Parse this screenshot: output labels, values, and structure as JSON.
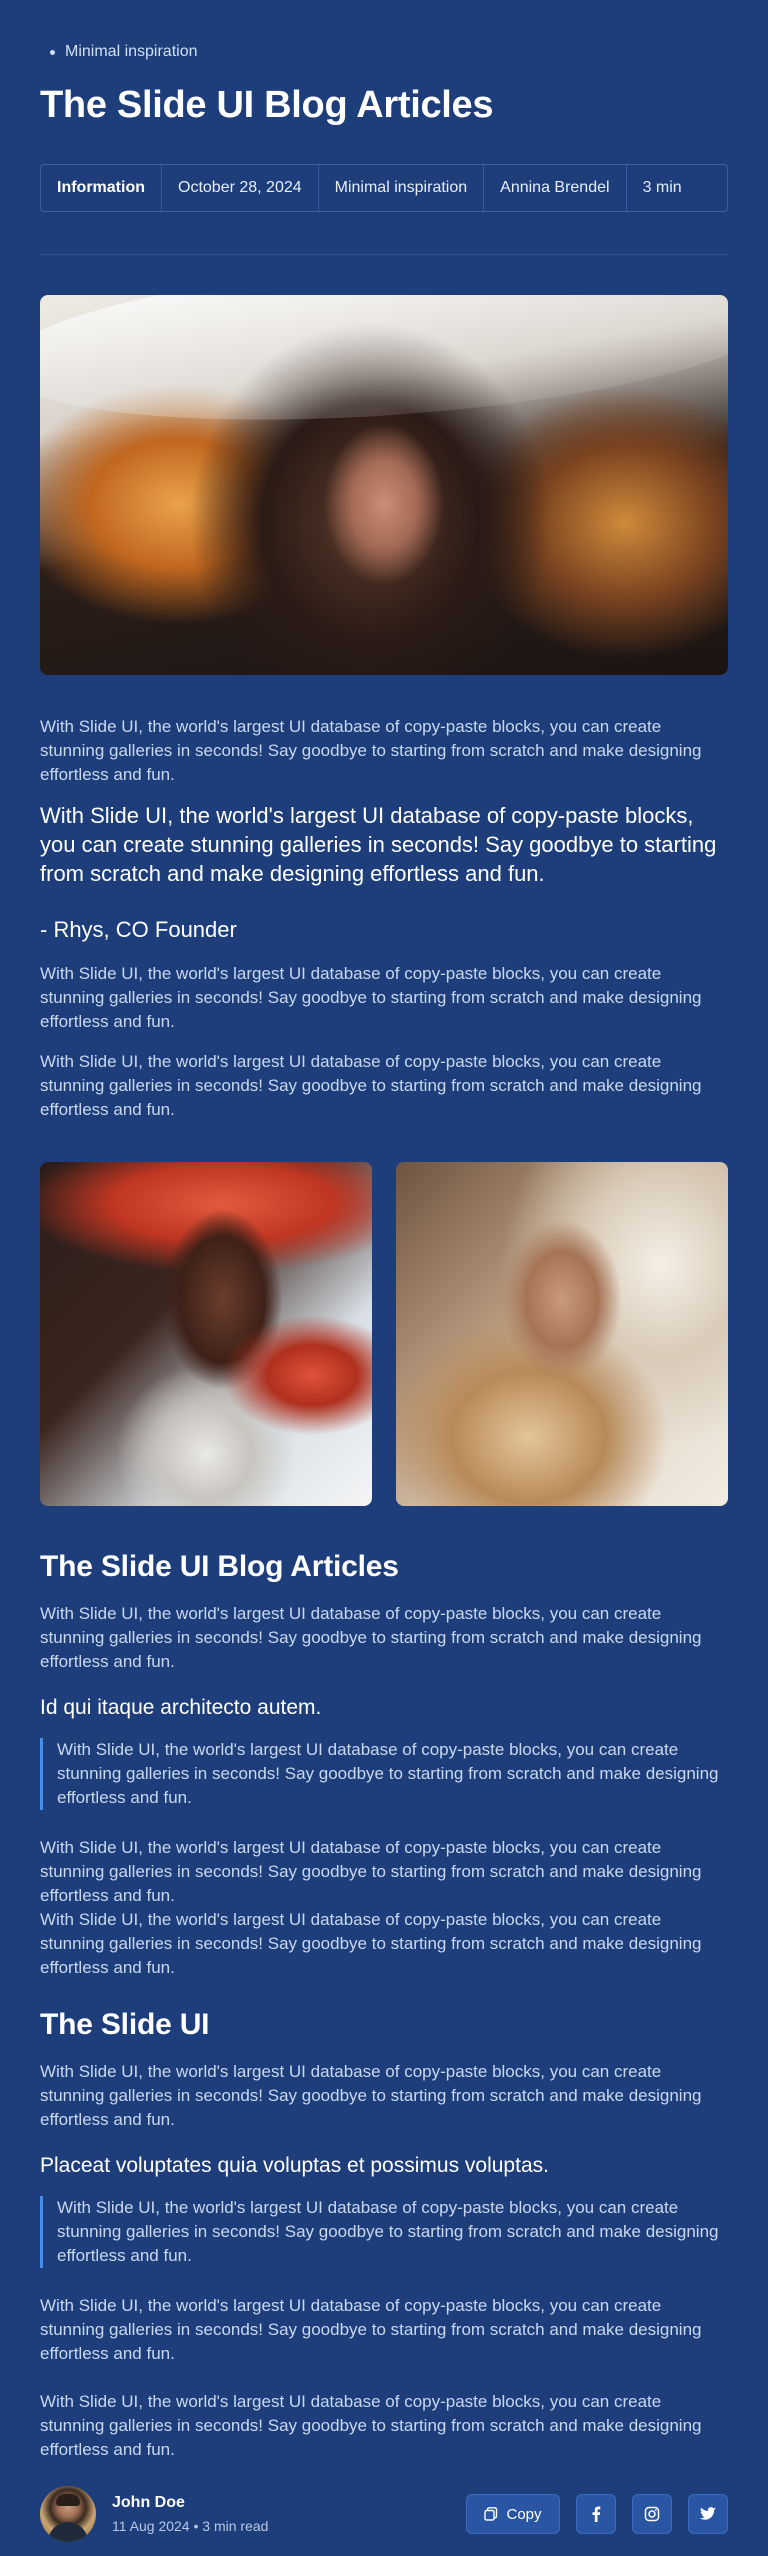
{
  "breadcrumb": {
    "label": "Minimal inspiration"
  },
  "page_title": "The Slide UI Blog Articles",
  "meta": {
    "info": "Information",
    "date": "October 28, 2024",
    "category": "Minimal inspiration",
    "author": "Annina Brendel",
    "read": "3 min"
  },
  "article": {
    "p1": "With Slide UI, the world's largest UI database of copy-paste blocks, you can create stunning galleries in seconds! Say goodbye to starting from scratch and make designing effortless and fun.",
    "quote": "With Slide UI, the world's largest UI database of copy-paste blocks, you can create stunning galleries in seconds! Say goodbye to starting from scratch and make designing effortless and fun.",
    "quote_author": "- Rhys, CO Founder",
    "p2": "With Slide UI, the world's largest UI database of copy-paste blocks, you can create stunning galleries in seconds! Say goodbye to starting from scratch and make designing effortless and fun.",
    "p3": "With Slide UI, the world's largest UI database of copy-paste blocks, you can create stunning galleries in seconds! Say goodbye to starting from scratch and make designing effortless and fun.",
    "section1": {
      "heading": "The Slide UI Blog Articles",
      "p1": "With Slide UI, the world's largest UI database of copy-paste blocks, you can create stunning galleries in seconds! Say goodbye to starting from scratch and make designing effortless and fun.",
      "subheading": "Id qui itaque architecto autem.",
      "blockquote": "With Slide UI, the world's largest UI database of copy-paste blocks, you can create stunning galleries in seconds! Say goodbye to starting from scratch and make designing effortless and fun.",
      "p2": "With Slide UI, the world's largest UI database of copy-paste blocks, you can create stunning galleries in seconds! Say goodbye to starting from scratch and make designing effortless and fun.",
      "p3": "With Slide UI, the world's largest UI database of copy-paste blocks, you can create stunning galleries in seconds! Say goodbye to starting from scratch and make designing effortless and fun."
    },
    "section2": {
      "heading": "The Slide UI",
      "p1": "With Slide UI, the world's largest UI database of copy-paste blocks, you can create stunning galleries in seconds! Say goodbye to starting from scratch and make designing effortless and fun.",
      "subheading": "Placeat voluptates quia voluptas et possimus voluptas.",
      "blockquote": "With Slide UI, the world's largest UI database of copy-paste blocks, you can create stunning galleries in seconds! Say goodbye to starting from scratch and make designing effortless and fun.",
      "p2": "With Slide UI, the world's largest UI database of copy-paste blocks, you can create stunning galleries in seconds! Say goodbye to starting from scratch and make designing effortless and fun.",
      "p3": "With Slide UI, the world's largest UI database of copy-paste blocks, you can create stunning galleries in seconds! Say goodbye to starting from scratch and make designing effortless and fun."
    }
  },
  "footer": {
    "name": "John Doe",
    "date": "11 Aug 2024",
    "separator": "•",
    "read": "3 min read",
    "copy_label": "Copy",
    "icons": [
      "copy-icon",
      "facebook-icon",
      "instagram-icon",
      "twitter-icon"
    ]
  },
  "colors": {
    "background": "#1d3e7a",
    "text": "#ffffff",
    "muted_text": "#c9d8f0",
    "border": "#3a5fa0",
    "accent": "#4b8ee6",
    "button": "#2a55a3"
  }
}
